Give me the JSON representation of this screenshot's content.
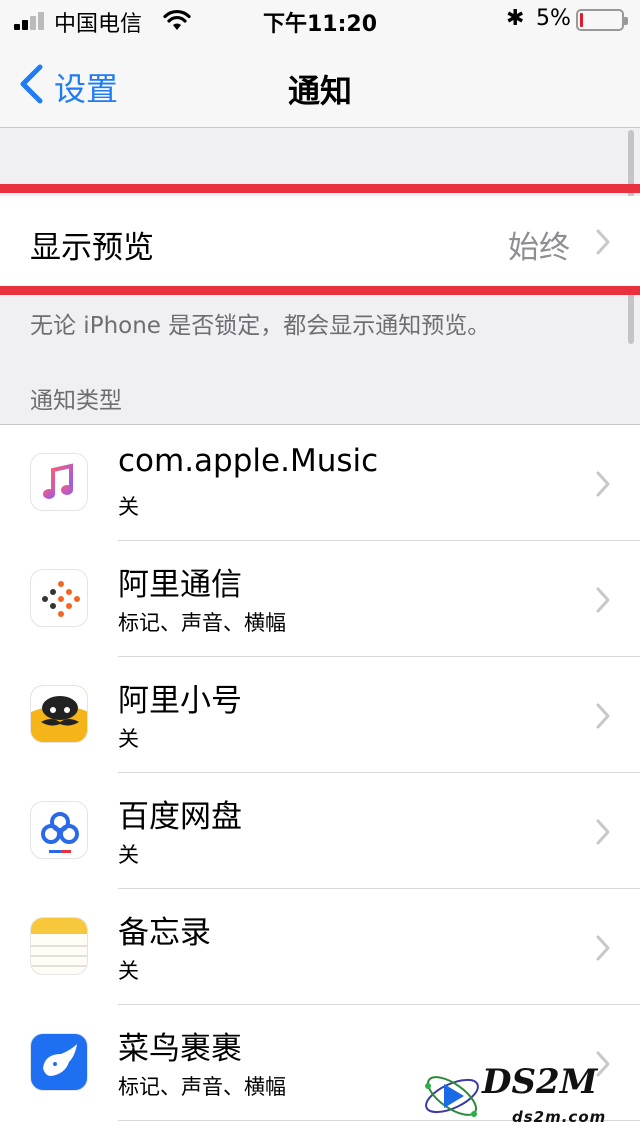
{
  "status_bar": {
    "carrier": "中国电信",
    "time": "下午11:20",
    "bluetooth_icon": "✱",
    "battery_percent": "5%",
    "battery_level": 0.05,
    "battery_color": "#e0192d"
  },
  "nav": {
    "back_label": "设置",
    "title": "通知",
    "accent_color": "#1f7cf5"
  },
  "preview": {
    "label": "显示预览",
    "value": "始终",
    "footnote": "无论 iPhone 是否锁定，都会显示通知预览。",
    "highlight_color": "#e8303e"
  },
  "section_header": "通知类型",
  "apps": [
    {
      "name": "com.apple.Music",
      "sub": "关",
      "icon": "music-icon"
    },
    {
      "name": "阿里通信",
      "sub": "标记、声音、横幅",
      "icon": "ali-communication-icon"
    },
    {
      "name": "阿里小号",
      "sub": "关",
      "icon": "ali-xiaohao-icon"
    },
    {
      "name": "百度网盘",
      "sub": "关",
      "icon": "baidu-netdisk-icon"
    },
    {
      "name": "备忘录",
      "sub": "关",
      "icon": "notes-icon"
    },
    {
      "name": "菜鸟裹裹",
      "sub": "标记、声音、横幅",
      "icon": "cainiao-icon"
    }
  ],
  "watermark": {
    "text": "DS2M",
    "sub": "ds2m.com"
  }
}
